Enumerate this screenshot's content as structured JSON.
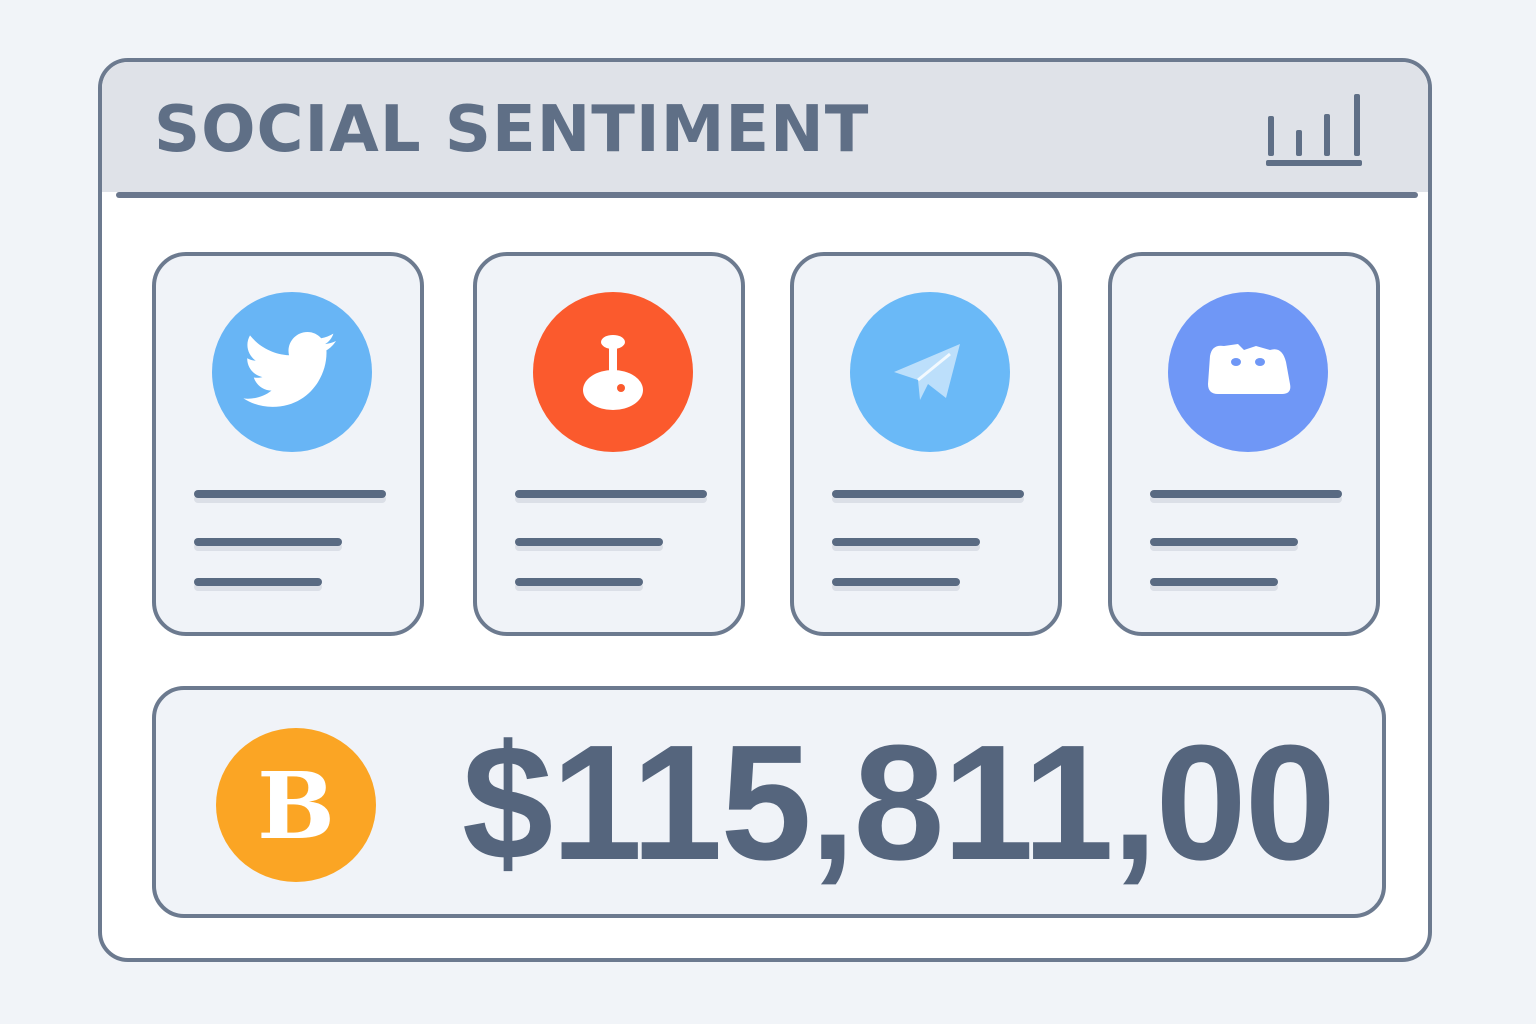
{
  "widget": {
    "title": "SOCIAL SENTIMENT",
    "header_icon": "bar-chart-icon"
  },
  "sources": [
    {
      "name": "twitter",
      "icon": "twitter-bird-icon",
      "color": "#68b5f5"
    },
    {
      "name": "reddit",
      "icon": "reddit-alien-icon",
      "color": "#fb5a2d"
    },
    {
      "name": "telegram",
      "icon": "telegram-plane-icon",
      "color": "#6ab9f7"
    },
    {
      "name": "discord",
      "icon": "discord-controller-icon",
      "color": "#6f97f6"
    }
  ],
  "price": {
    "coin_icon": "bitcoin-icon",
    "coin_color": "#fba524",
    "value": "$115,811,00"
  },
  "colors": {
    "frame": "#6c7a8f",
    "text": "#55657d",
    "header_bg": "#dfe2e8",
    "card_bg": "#f0f3f8"
  }
}
